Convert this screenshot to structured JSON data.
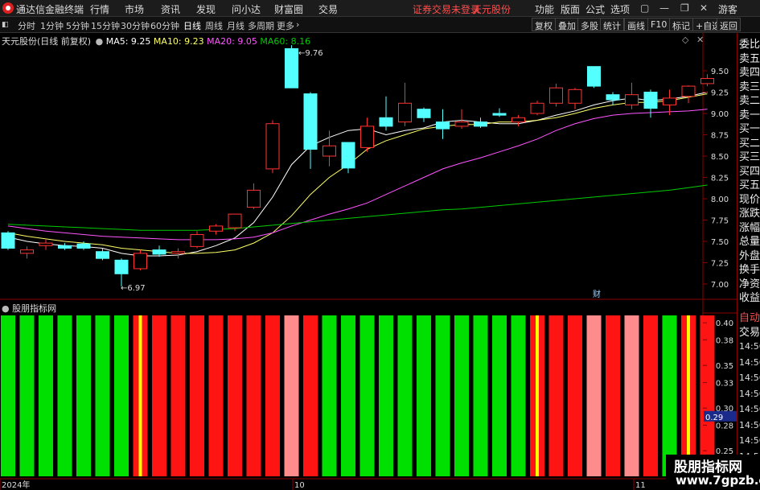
{
  "titlebar": {
    "app_title": "通达信金融终端",
    "menus": [
      "行情",
      "市场",
      "资讯",
      "发现",
      "问小达",
      "财富圈",
      "交易"
    ],
    "broker_status": "证券交易未登录",
    "stock_name": "天元股份",
    "right_menus": [
      "功能",
      "版面",
      "公式",
      "选项"
    ],
    "user": "游客"
  },
  "toolbar": {
    "periods": [
      "分时",
      "1分钟",
      "5分钟",
      "15分钟",
      "30分钟",
      "60分钟",
      "日线",
      "周线",
      "月线",
      "多周期",
      "更多"
    ],
    "active_period": "日线",
    "buttons": [
      "复权",
      "叠加",
      "多股",
      "统计",
      "画线",
      "F10",
      "标记",
      "+自选",
      "返回"
    ]
  },
  "chart_header": {
    "stock": "天元股份(日线 前复权)",
    "ma5": "MA5: 9.25",
    "ma10": "MA10: 9.23",
    "ma20": "MA20: 9.05",
    "ma60": "MA60: 8.16"
  },
  "indicator_header": "股朋指标网",
  "right_panel": {
    "labels": [
      "委比",
      "卖五",
      "卖四",
      "卖三",
      "卖二",
      "卖一",
      "买一",
      "买二",
      "买三",
      "买四",
      "买五",
      "现价",
      "涨跌",
      "涨幅",
      "总量",
      "外盘",
      "换手",
      "净资",
      "收益"
    ],
    "lower_labels": [
      "自动",
      "交易"
    ],
    "lower_values": [
      "14:56",
      "14:56",
      "14:56",
      "14:56",
      "14:56",
      "14:56",
      "14:56",
      "14:56",
      "14:56"
    ]
  },
  "annotations": {
    "high_label": "9.76",
    "low_label": "6.97",
    "fin_marker": "财",
    "indicator_current": "0.29"
  },
  "x_axis_labels": [
    "2024年",
    "10",
    "11"
  ],
  "watermark": {
    "title": "股朋指标网",
    "url": "www.7gpzb.com"
  },
  "colors": {
    "up": "#ff3232",
    "down": "#54ffff",
    "ma5": "#ffffff",
    "ma10": "#ffff66",
    "ma20": "#ff55ff",
    "ma60": "#00cc00",
    "bar_green": "#00e000",
    "bar_red": "#ff1414",
    "bar_pink": "#ff8c8c",
    "bar_yellow": "#ffff00"
  },
  "chart_data": [
    {
      "type": "candlestick",
      "title": "天元股份(日线 前复权)",
      "ylim": [
        6.9,
        9.8
      ],
      "y_ticks": [
        7.0,
        7.25,
        7.5,
        7.75,
        8.0,
        8.25,
        8.5,
        8.75,
        9.0,
        9.25,
        9.5
      ],
      "candles": [
        {
          "o": 7.6,
          "h": 7.62,
          "l": 7.4,
          "c": 7.42
        },
        {
          "o": 7.36,
          "h": 7.44,
          "l": 7.3,
          "c": 7.4
        },
        {
          "o": 7.45,
          "h": 7.52,
          "l": 7.4,
          "c": 7.48
        },
        {
          "o": 7.45,
          "h": 7.48,
          "l": 7.4,
          "c": 7.42
        },
        {
          "o": 7.47,
          "h": 7.5,
          "l": 7.4,
          "c": 7.42
        },
        {
          "o": 7.38,
          "h": 7.42,
          "l": 7.28,
          "c": 7.3
        },
        {
          "o": 7.28,
          "h": 7.3,
          "l": 6.97,
          "c": 7.12
        },
        {
          "o": 7.18,
          "h": 7.4,
          "l": 7.16,
          "c": 7.36
        },
        {
          "o": 7.4,
          "h": 7.45,
          "l": 7.32,
          "c": 7.35
        },
        {
          "o": 7.36,
          "h": 7.42,
          "l": 7.3,
          "c": 7.38
        },
        {
          "o": 7.44,
          "h": 7.62,
          "l": 7.42,
          "c": 7.58
        },
        {
          "o": 7.62,
          "h": 7.7,
          "l": 7.58,
          "c": 7.68
        },
        {
          "o": 7.66,
          "h": 7.8,
          "l": 7.62,
          "c": 7.82
        },
        {
          "o": 7.9,
          "h": 8.18,
          "l": 7.88,
          "c": 8.1
        },
        {
          "o": 8.35,
          "h": 8.92,
          "l": 8.3,
          "c": 8.88
        },
        {
          "o": 9.76,
          "h": 9.8,
          "l": 9.3,
          "c": 9.3
        },
        {
          "o": 9.23,
          "h": 9.25,
          "l": 8.35,
          "c": 8.58
        },
        {
          "o": 8.5,
          "h": 8.8,
          "l": 8.38,
          "c": 8.62
        },
        {
          "o": 8.66,
          "h": 8.66,
          "l": 8.3,
          "c": 8.36
        },
        {
          "o": 8.6,
          "h": 8.95,
          "l": 8.55,
          "c": 8.85
        },
        {
          "o": 8.95,
          "h": 9.2,
          "l": 8.8,
          "c": 8.85
        },
        {
          "o": 8.9,
          "h": 9.36,
          "l": 8.85,
          "c": 9.12
        },
        {
          "o": 9.05,
          "h": 9.07,
          "l": 8.9,
          "c": 8.95
        },
        {
          "o": 8.9,
          "h": 9.05,
          "l": 8.7,
          "c": 8.82
        },
        {
          "o": 8.85,
          "h": 9.05,
          "l": 8.82,
          "c": 8.9
        },
        {
          "o": 8.9,
          "h": 8.95,
          "l": 8.83,
          "c": 8.85
        },
        {
          "o": 9.0,
          "h": 9.06,
          "l": 8.96,
          "c": 8.98
        },
        {
          "o": 8.9,
          "h": 8.98,
          "l": 8.85,
          "c": 8.95
        },
        {
          "o": 9.0,
          "h": 9.15,
          "l": 8.98,
          "c": 9.12
        },
        {
          "o": 9.12,
          "h": 9.35,
          "l": 9.08,
          "c": 9.3
        },
        {
          "o": 9.12,
          "h": 9.3,
          "l": 9.05,
          "c": 9.28
        },
        {
          "o": 9.55,
          "h": 9.55,
          "l": 9.3,
          "c": 9.32
        },
        {
          "o": 9.22,
          "h": 9.25,
          "l": 9.1,
          "c": 9.16
        },
        {
          "o": 9.1,
          "h": 9.36,
          "l": 9.05,
          "c": 9.22
        },
        {
          "o": 9.25,
          "h": 9.28,
          "l": 8.95,
          "c": 9.06
        },
        {
          "o": 9.1,
          "h": 9.28,
          "l": 8.98,
          "c": 9.18
        },
        {
          "o": 9.2,
          "h": 9.33,
          "l": 9.12,
          "c": 9.32
        },
        {
          "o": 9.35,
          "h": 9.46,
          "l": 9.32,
          "c": 9.41
        }
      ],
      "ma": {
        "MA5": [
          7.55,
          7.5,
          7.47,
          7.45,
          7.44,
          7.42,
          7.36,
          7.33,
          7.33,
          7.34,
          7.38,
          7.45,
          7.54,
          7.72,
          8.02,
          8.4,
          8.62,
          8.72,
          8.8,
          8.82,
          8.75,
          8.8,
          8.83,
          8.9,
          8.92,
          8.9,
          8.88,
          8.88,
          8.92,
          8.98,
          9.03,
          9.1,
          9.15,
          9.18,
          9.15,
          9.17,
          9.2,
          9.25
        ],
        "MA10": [
          7.6,
          7.56,
          7.53,
          7.5,
          7.48,
          7.46,
          7.42,
          7.4,
          7.38,
          7.36,
          7.36,
          7.37,
          7.4,
          7.48,
          7.6,
          7.8,
          8.05,
          8.25,
          8.4,
          8.58,
          8.68,
          8.75,
          8.82,
          8.85,
          8.87,
          8.87,
          8.9,
          8.9,
          8.92,
          8.95,
          9.0,
          9.06,
          9.1,
          9.13,
          9.13,
          9.15,
          9.19,
          9.23
        ],
        "MA20": [
          7.68,
          7.65,
          7.62,
          7.6,
          7.58,
          7.56,
          7.55,
          7.54,
          7.53,
          7.52,
          7.52,
          7.52,
          7.53,
          7.55,
          7.6,
          7.68,
          7.75,
          7.82,
          7.88,
          7.95,
          8.05,
          8.15,
          8.25,
          8.35,
          8.42,
          8.48,
          8.55,
          8.62,
          8.7,
          8.8,
          8.88,
          8.94,
          8.98,
          9.0,
          9.01,
          9.02,
          9.03,
          9.05
        ],
        "MA60": [
          7.7,
          7.69,
          7.68,
          7.67,
          7.66,
          7.65,
          7.64,
          7.63,
          7.63,
          7.63,
          7.63,
          7.64,
          7.65,
          7.67,
          7.69,
          7.71,
          7.73,
          7.75,
          7.77,
          7.79,
          7.81,
          7.83,
          7.85,
          7.87,
          7.88,
          7.9,
          7.92,
          7.94,
          7.96,
          7.98,
          8.0,
          8.02,
          8.04,
          8.06,
          8.08,
          8.1,
          8.13,
          8.16
        ]
      }
    },
    {
      "type": "bar",
      "title": "股朋指标网",
      "ylim": [
        0.22,
        0.41
      ],
      "y_ticks": [
        0.4,
        0.38,
        0.35,
        0.33,
        0.3,
        0.28,
        0.25,
        0.23
      ],
      "current_value": 0.29,
      "bar_colors": [
        "green",
        "green",
        "green",
        "green",
        "green",
        "green",
        "green",
        "yellow",
        "red",
        "red",
        "red",
        "red",
        "red",
        "red",
        "red",
        "pink",
        "red",
        "green",
        "green",
        "green",
        "green",
        "green",
        "green",
        "green",
        "green",
        "green",
        "green",
        "green",
        "yellow",
        "red",
        "red",
        "pink",
        "red",
        "pink",
        "red",
        "green",
        "yellow",
        "red"
      ]
    }
  ]
}
